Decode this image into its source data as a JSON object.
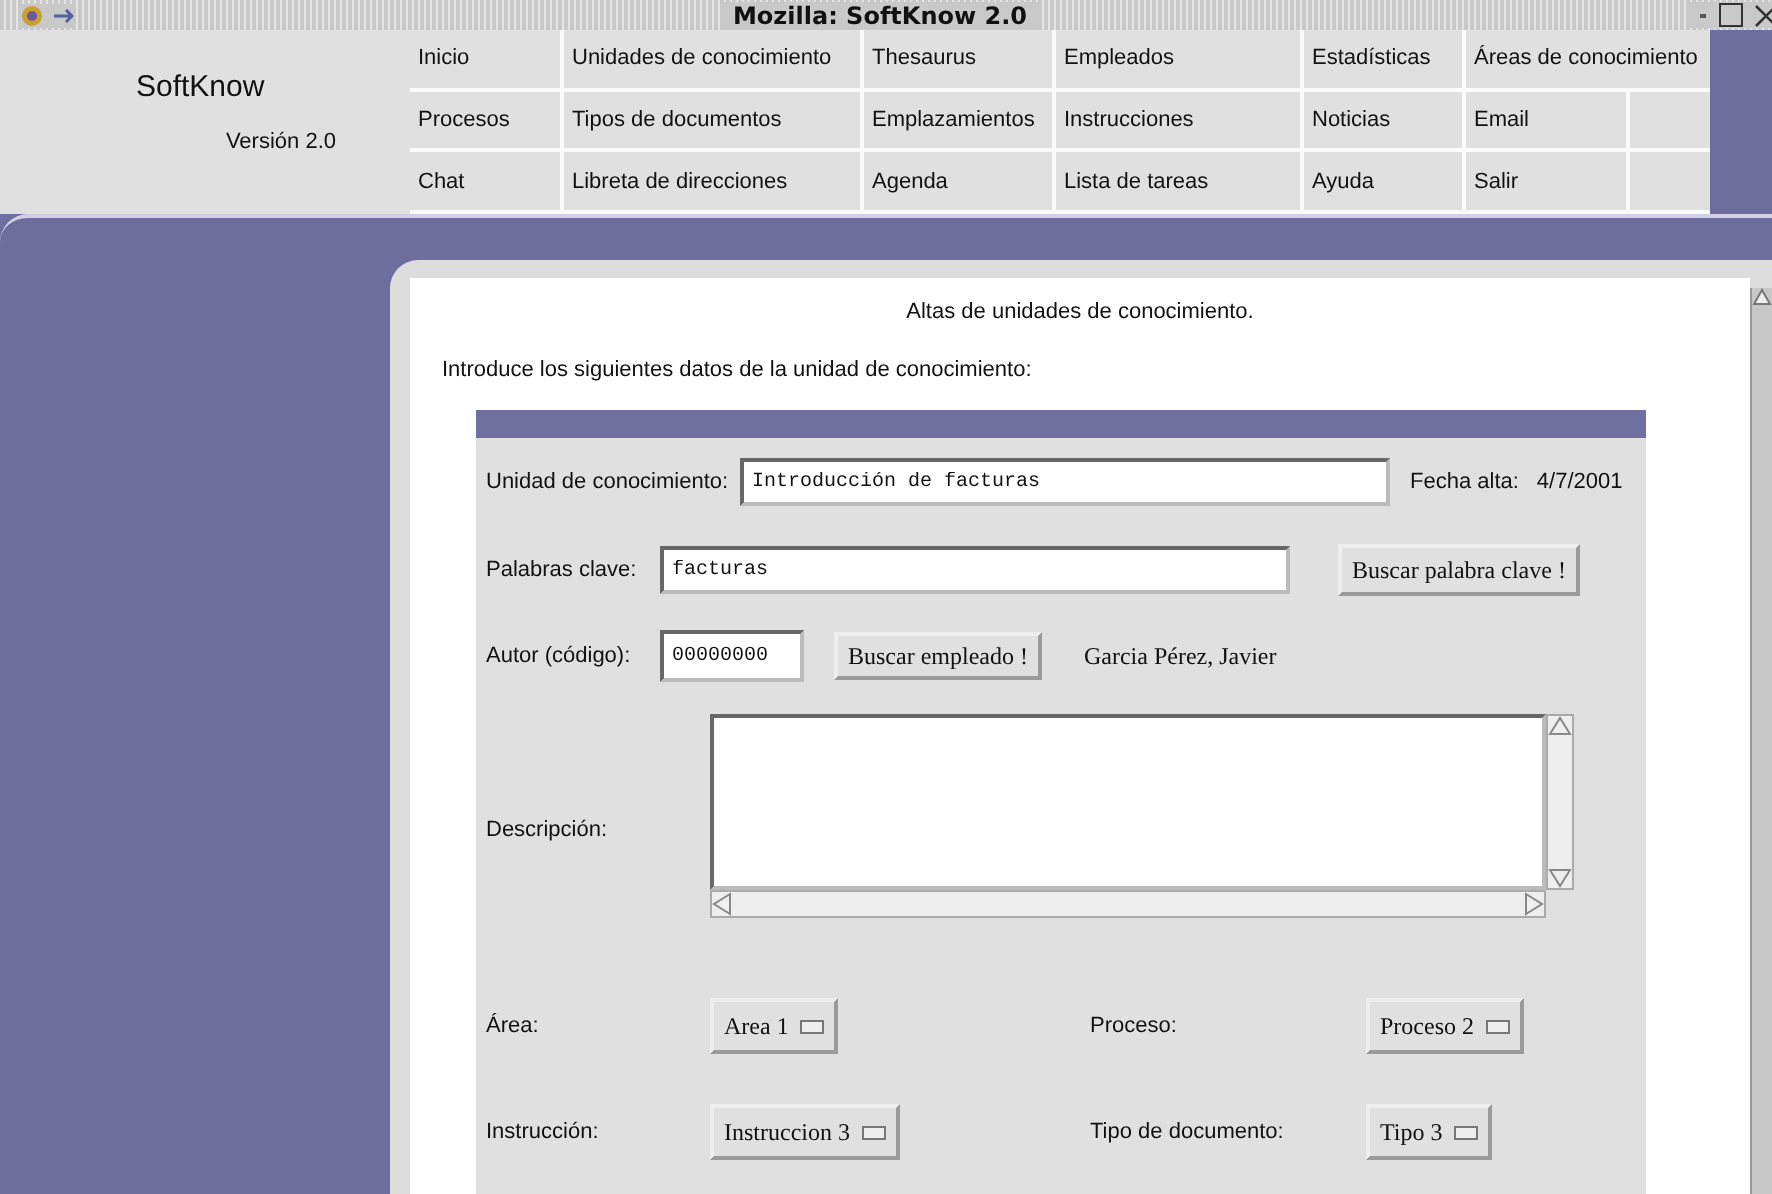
{
  "window": {
    "title": "Mozilla: SoftKnow 2.0"
  },
  "header": {
    "logo": "SoftKnow",
    "version": "Versión 2.0",
    "menu": [
      [
        "Inicio",
        "Unidades de conocimiento",
        "Thesaurus",
        "Empleados",
        "Estadísticas",
        "Áreas de conocimiento"
      ],
      [
        "Procesos",
        "Tipos de documentos",
        "Emplazamientos",
        "Instrucciones",
        "Noticias",
        "Email"
      ],
      [
        "Chat",
        "Libreta de direcciones",
        "Agenda",
        "Lista de tareas",
        "Ayuda",
        "Salir"
      ]
    ]
  },
  "page": {
    "heading": "Altas de unidades de conocimiento.",
    "intro": "Introduce los siguientes datos de la unidad de conocimiento:",
    "form": {
      "unit": {
        "label": "Unidad de conocimiento:",
        "value": "Introducción de facturas"
      },
      "date": {
        "label": "Fecha alta:",
        "value": "4/7/2001"
      },
      "keywords": {
        "label": "Palabras clave:",
        "value": "facturas",
        "button": "Buscar palabra clave !"
      },
      "author": {
        "label": "Autor (código):",
        "value": "00000000",
        "button": "Buscar empleado !",
        "name": "Garcia Pérez, Javier"
      },
      "description": {
        "label": "Descripción:"
      },
      "selects": [
        {
          "label": "Área:",
          "value": "Area 1"
        },
        {
          "label": "Proceso:",
          "value": "Proceso 2"
        },
        {
          "label": "Instrucción:",
          "value": "Instruccion 3"
        },
        {
          "label": "Tipo de documento:",
          "value": "Tipo 3"
        }
      ]
    }
  }
}
